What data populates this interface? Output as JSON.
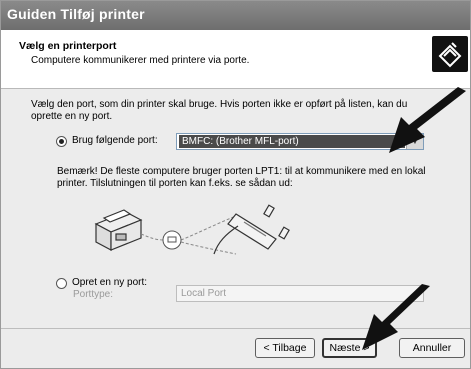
{
  "window": {
    "title": "Guiden Tilføj printer"
  },
  "header": {
    "title": "Vælg en printerport",
    "subtitle": "Computere kommunikerer med printere via porte."
  },
  "body": {
    "intro": "Vælg den port, som din printer skal bruge. Hvis porten ikke er opført på listen, kan du oprette en ny port.",
    "option_use": {
      "label": "Brug følgende port:",
      "selected": true,
      "value": "BMFC: (Brother MFL-port)"
    },
    "note": "Bemærk! De fleste computere bruger porten LPT1: til at kommunikere med en lokal printer. Tilslutningen til porten kan f.eks. se sådan ud:",
    "option_new": {
      "label": "Opret en ny port:",
      "selected": false
    },
    "porttype": {
      "label": "Porttype:",
      "value": "Local Port"
    }
  },
  "buttons": {
    "back": "< Tilbage",
    "next": "Næste >",
    "cancel": "Annuller"
  },
  "icons": {
    "header_logo": "printer-wizard-icon",
    "dropdown": "chevron-down-icon"
  }
}
